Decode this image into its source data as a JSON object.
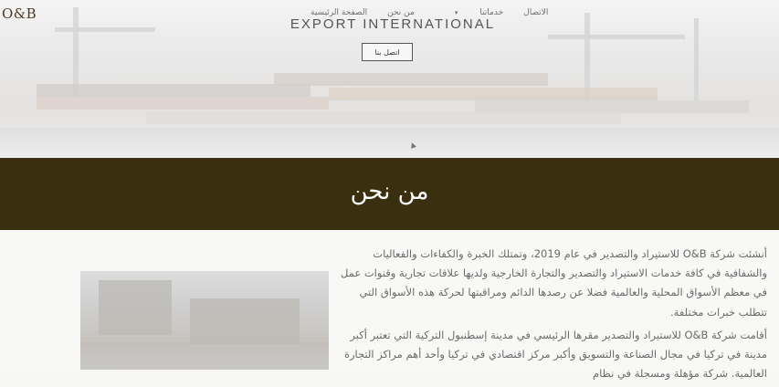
{
  "brand": {
    "logo_text": "O&B"
  },
  "nav": {
    "items": [
      {
        "label": "الصفحة الرئيسية"
      },
      {
        "label": "من نحن"
      },
      {
        "label": "خدماتنا",
        "has_dropdown": true
      },
      {
        "label": "الاتصال"
      }
    ]
  },
  "hero": {
    "title": "EXPORT INTERNATIONAL",
    "contact_button": "اتصل بنا"
  },
  "about": {
    "heading": "من نحن",
    "paragraphs": [
      "أنشئت شركة O&B للاستيراد والتصدير في عام 2019، وتمتلك الخبرة والكفاءات والفعاليات والشفافية في كافة خدمات الاستيراد والتصدير والتجارة الخارجية ولديها علاقات تجارية وقنوات عمل في معظم الأسواق المحلية والعالمية فضلا عن رصدها الدائم ومراقبتها لحركة هذه الأسواق التي تتطلب خبرات مختلفة.",
      "أقامت شركة O&B للاستيراد والتصدير مقرها الرئيسي في مدينة إسطنبول التركية التي تعتبر أكبر مدينة في تركيا في مجال الصناعة والتسويق وأكبر مركز اقتصادي في تركيا وأحد أهم مراكز التجارة العالمية. شركة مؤهلة ومسجلة في نظام"
    ]
  },
  "colors": {
    "banner_bg": "#3a3010",
    "brand_text": "#4a3a22",
    "body_text": "#6a6a6a"
  }
}
